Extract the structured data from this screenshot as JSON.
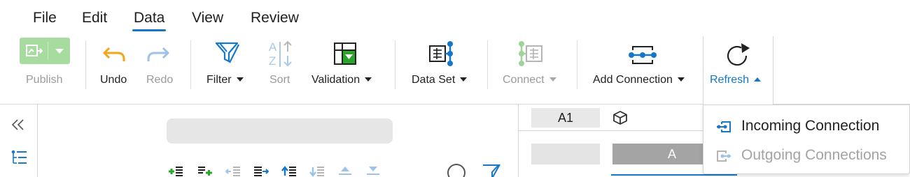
{
  "menu": {
    "items": [
      "File",
      "Edit",
      "Data",
      "View",
      "Review"
    ],
    "active": "Data"
  },
  "toolbar": {
    "publish_label": "Publish",
    "undo_label": "Undo",
    "redo_label": "Redo",
    "filter_label": "Filter",
    "sort_label": "Sort",
    "validation_label": "Validation",
    "dataset_label": "Data Set",
    "connect_label": "Connect",
    "add_connection_label": "Add Connection",
    "refresh_label": "Refresh",
    "sort_glyph_a": "A",
    "sort_glyph_z": "Z"
  },
  "sheet": {
    "cell_ref": "A1",
    "column_header": "A"
  },
  "refresh_menu": {
    "items": [
      {
        "label": "Incoming Connection",
        "enabled": true,
        "icon": "incoming-connection-icon"
      },
      {
        "label": "Outgoing Connections",
        "enabled": false,
        "icon": "outgoing-connection-icon"
      }
    ]
  },
  "colors": {
    "accent": "#1677c9",
    "publish_green": "#a8dba0",
    "undo_orange": "#f2a516",
    "validation_green": "#2aa52a",
    "disabled": "#a3a3a3"
  }
}
